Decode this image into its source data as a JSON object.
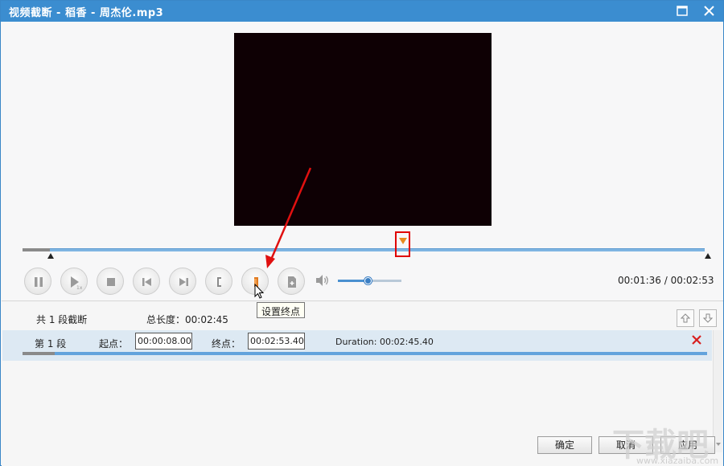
{
  "window": {
    "title": "视频截断 - 稻香 - 周杰伦.mp3"
  },
  "player": {
    "time_current": "00:01:36",
    "time_total": "00:02:53",
    "time_readout": "00:01:36 / 00:02:53",
    "volume_fraction": 0.48,
    "tooltip": "设置终点",
    "controls": [
      {
        "name": "pause-button",
        "icon": "pause-icon"
      },
      {
        "name": "play-step-button",
        "icon": "play-icon"
      },
      {
        "name": "stop-button",
        "icon": "stop-icon"
      },
      {
        "name": "previous-button",
        "icon": "skip-back-icon"
      },
      {
        "name": "next-button",
        "icon": "skip-forward-icon"
      },
      {
        "name": "set-start-button",
        "icon": "set-start-icon"
      },
      {
        "name": "set-end-button",
        "icon": "set-end-icon"
      },
      {
        "name": "add-segment-button",
        "icon": "add-segment-icon"
      }
    ]
  },
  "list": {
    "summary": "共 1 段截断",
    "total_length": "总长度：00:02:45",
    "segments": [
      {
        "label": "第 1 段",
        "start_label": "起点：",
        "start": "00:00:08.00",
        "end_label": "终点：",
        "end": "00:02:53.40",
        "duration": "Duration: 00:02:45.40"
      }
    ]
  },
  "buttons": {
    "ok": "确定",
    "cancel": "取消",
    "apply": "应用"
  },
  "watermark": {
    "text": "下载吧",
    "url": "www.xiazaiba.com"
  },
  "colors": {
    "titlebar": "#3b8dd0",
    "accent": "#4a90d0",
    "highlight_box": "#e00000",
    "arrow": "#e01010",
    "cursor_marker": "#e88a1e"
  }
}
